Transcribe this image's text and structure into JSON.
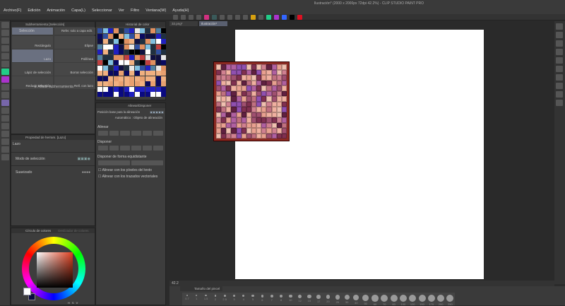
{
  "window": {
    "title": "Ilustración* (2000 x 2000px 72dpi 42.2%) - CLIP STUDIO PAINT PRO"
  },
  "menu": [
    "Archivo(F)",
    "Edición",
    "Animación",
    "Capa(L)",
    "Seleccionar",
    "Ver",
    "Filtro",
    "Ventana(W)",
    "Ayuda(H)"
  ],
  "subtool": {
    "title": "Subherramienta [Selección]",
    "group": "Selección",
    "ref_label": "Refer. solo a capa edit.",
    "items": [
      "Rectángulo",
      "Elipse",
      "Lazo",
      "Polilínea",
      "Lápiz de selección",
      "Borrar selección",
      "Reducir selección",
      "Rell. con lazo"
    ],
    "add": "Añadir subherramienta"
  },
  "tool_property": {
    "title": "Propiedad de herram. [Lazo]",
    "tool": "Lazo",
    "rows": [
      "Modo de selección",
      "Suavizado"
    ]
  },
  "color_wheel": {
    "tab1": "Círculo de colores",
    "tab2": "Deslizador de colores",
    "values": [
      "H",
      "S",
      "V"
    ]
  },
  "color_history": {
    "title": "Historial de color"
  },
  "align": {
    "title": "Alinear/Disponer",
    "base_label": "Posición base para la alineación",
    "auto": "Automático : Objeto de alineación",
    "align_label": "Alinear",
    "arrange_label": "Disponer",
    "equal_label": "Disponer de forma equidistante",
    "check1": "Alinear con los píxeles del texto",
    "check2": "Alinear con los trazados vectoriales"
  },
  "canvas": {
    "tabs": [
      "32.png*",
      "Ilustración*"
    ],
    "zoom": "42.2"
  },
  "brush_size": {
    "title": "Tamaño del pincel",
    "sizes": [
      "0.7",
      "1",
      "1.5",
      "2",
      "2.5",
      "3",
      "4",
      "5",
      "6",
      "7",
      "8",
      "10",
      "12",
      "15",
      "17",
      "20",
      "25",
      "30",
      "40",
      "50",
      "60",
      "70",
      "80",
      "100",
      "120",
      "150",
      "170",
      "200",
      "250"
    ]
  }
}
